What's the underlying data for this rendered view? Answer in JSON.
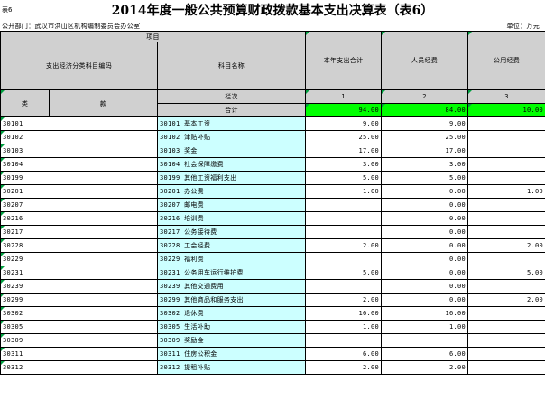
{
  "header": {
    "tag": "表6",
    "title": "2014年度一般公共预算财政拨款基本支出决算表（表6）",
    "dept": "公开部门：武汉市洪山区机构编制委员会办公室",
    "unit": "单位：万元"
  },
  "table": {
    "h_project": "项目",
    "h_code": "支出经济分类科目编码",
    "h_name": "科目名称",
    "h_total": "本年支出合计",
    "h_personnel": "人员经费",
    "h_public": "公用经费",
    "h_lei": "类",
    "h_kuan": "款",
    "h_rownum": "栏次",
    "col1": "1",
    "col2": "2",
    "col3": "3",
    "sum_label": "合计",
    "sum_total": "94.00",
    "sum_personnel": "84.00",
    "sum_public": "10.00",
    "rows": [
      {
        "code": "30101",
        "name": "30101 基本工资",
        "total": "9.00",
        "personnel": "9.00",
        "public": ""
      },
      {
        "code": "30102",
        "name": "30102 津贴补贴",
        "total": "25.00",
        "personnel": "25.00",
        "public": ""
      },
      {
        "code": "30103",
        "name": "30103 奖金",
        "total": "17.00",
        "personnel": "17.00",
        "public": ""
      },
      {
        "code": "30104",
        "name": "30104 社会保障缴费",
        "total": "3.00",
        "personnel": "3.00",
        "public": ""
      },
      {
        "code": "30199",
        "name": "30199 其他工资福利支出",
        "total": "5.00",
        "personnel": "5.00",
        "public": ""
      },
      {
        "code": "30201",
        "name": "30201 办公费",
        "total": "1.00",
        "personnel": "0.00",
        "public": "1.00"
      },
      {
        "code": "30207",
        "name": "30207 邮电费",
        "total": "",
        "personnel": "0.00",
        "public": ""
      },
      {
        "code": "30216",
        "name": "30216 培训费",
        "total": "",
        "personnel": "0.00",
        "public": ""
      },
      {
        "code": "30217",
        "name": "30217 公务接待费",
        "total": "",
        "personnel": "0.00",
        "public": ""
      },
      {
        "code": "30228",
        "name": "30228 工会经费",
        "total": "2.00",
        "personnel": "0.00",
        "public": "2.00"
      },
      {
        "code": "30229",
        "name": "30229 福利费",
        "total": "",
        "personnel": "0.00",
        "public": ""
      },
      {
        "code": "30231",
        "name": "30231 公务用车运行维护费",
        "total": "5.00",
        "personnel": "0.00",
        "public": "5.00"
      },
      {
        "code": "30239",
        "name": "30239 其他交通费用",
        "total": "",
        "personnel": "0.00",
        "public": ""
      },
      {
        "code": "30299",
        "name": "30299 其他商品和服务支出",
        "total": "2.00",
        "personnel": "0.00",
        "public": "2.00"
      },
      {
        "code": "30302",
        "name": "30302 退休费",
        "total": "16.00",
        "personnel": "16.00",
        "public": ""
      },
      {
        "code": "30305",
        "name": "30305 生活补助",
        "total": "1.00",
        "personnel": "1.00",
        "public": ""
      },
      {
        "code": "30309",
        "name": "30309 奖励金",
        "total": "",
        "personnel": "",
        "public": ""
      },
      {
        "code": "30311",
        "name": "30311 住房公积金",
        "total": "6.00",
        "personnel": "6.00",
        "public": ""
      },
      {
        "code": "30312",
        "name": "30312 提租补贴",
        "total": "2.00",
        "personnel": "2.00",
        "public": ""
      }
    ]
  }
}
